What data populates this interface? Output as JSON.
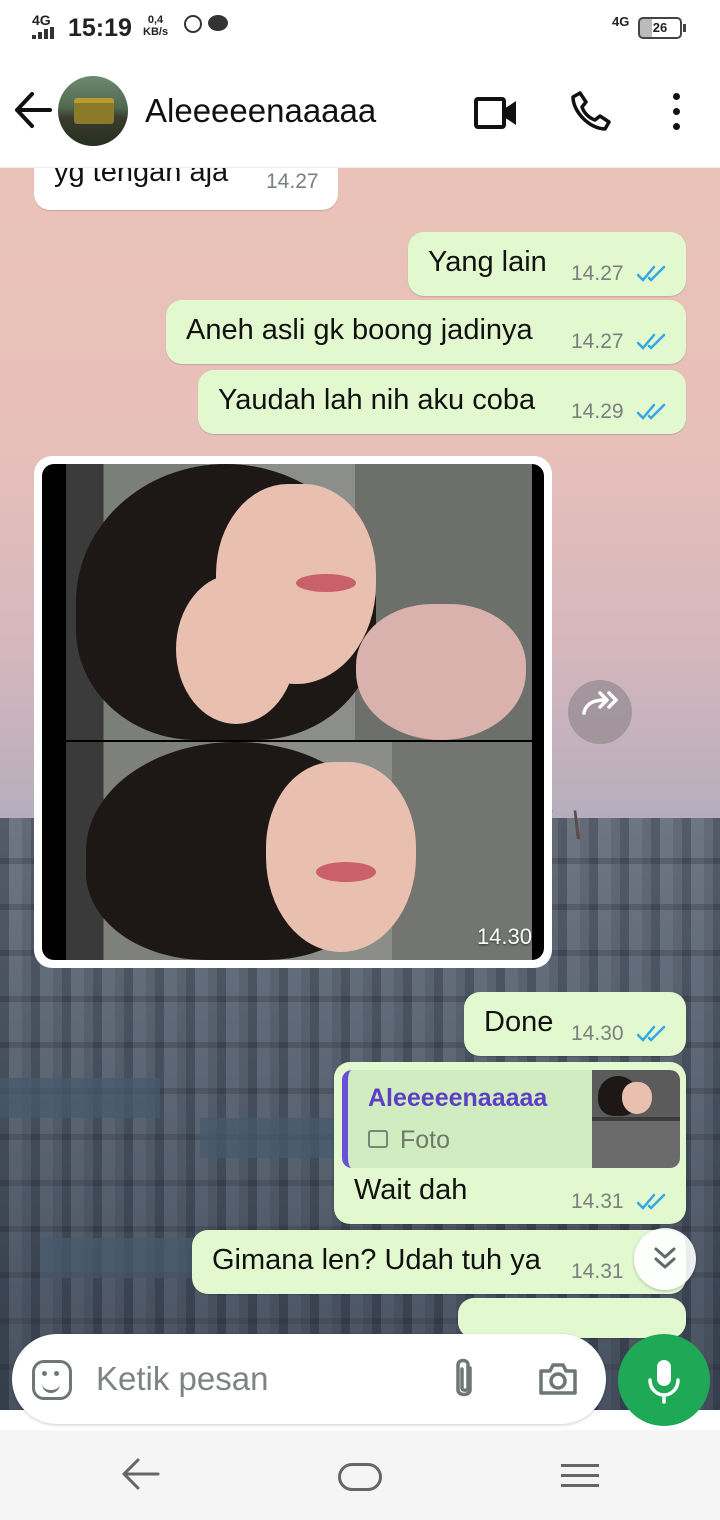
{
  "status_bar": {
    "network_left": "4G",
    "time": "15:19",
    "speed_value": "0,4",
    "speed_unit": "KB/s",
    "network_right": "4G",
    "battery": "26"
  },
  "header": {
    "contact_name": "Aleeeeenaaaaa",
    "icons": [
      "back-arrow-icon",
      "video-call-icon",
      "voice-call-icon",
      "more-options-icon"
    ]
  },
  "messages": [
    {
      "direction": "in",
      "text": "yg tengah aja",
      "time": "14.27"
    },
    {
      "direction": "out",
      "text": "Yang lain",
      "time": "14.27",
      "status": "read"
    },
    {
      "direction": "out",
      "text": "Aneh asli gk boong jadinya",
      "time": "14.27",
      "status": "read"
    },
    {
      "direction": "out",
      "text": "Yaudah lah nih aku coba",
      "time": "14.29",
      "status": "read"
    },
    {
      "direction": "in",
      "type": "photo",
      "time": "14.30"
    },
    {
      "direction": "out",
      "text": "Done",
      "time": "14.30",
      "status": "read"
    },
    {
      "direction": "out",
      "text": "Wait dah",
      "time": "14.31",
      "status": "read",
      "reply_to": {
        "name": "Aleeeeenaaaaa",
        "type": "Foto"
      }
    },
    {
      "direction": "out",
      "text": "Gimana len? Udah tuh ya",
      "time": "14.31",
      "status": "read"
    }
  ],
  "composer": {
    "placeholder": "Ketik pesan",
    "icons": [
      "sticker-icon",
      "attach-icon",
      "camera-icon",
      "mic-icon"
    ]
  },
  "colors": {
    "outgoing_bubble": "#e2f9cf",
    "incoming_bubble": "#ffffff",
    "read_ticks": "#34a6e6",
    "mic_button": "#1fa855",
    "reply_bar": "#6a4fd8"
  }
}
